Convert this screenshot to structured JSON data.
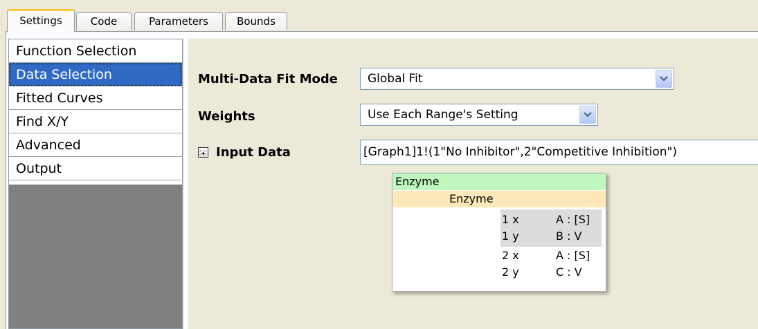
{
  "tabs": [
    {
      "label": "Settings",
      "active": true
    },
    {
      "label": "Code",
      "active": false
    },
    {
      "label": "Parameters",
      "active": false
    },
    {
      "label": "Bounds",
      "active": false
    }
  ],
  "nav": {
    "items": [
      {
        "label": "Function Selection"
      },
      {
        "label": "Data Selection",
        "selected": true
      },
      {
        "label": "Fitted Curves"
      },
      {
        "label": "Find X/Y"
      },
      {
        "label": "Advanced"
      },
      {
        "label": "Output"
      }
    ]
  },
  "form": {
    "multi_data_fit_mode": {
      "label": "Multi-Data Fit Mode",
      "value": "Global Fit"
    },
    "weights": {
      "label": "Weights",
      "value": "Use Each Range's Setting"
    },
    "input_data": {
      "label": "Input Data",
      "value": "[Graph1]1!(1\"No Inhibitor\",2\"Competitive Inhibition\")"
    }
  },
  "popup": {
    "level1": "Enzyme",
    "level2": "Enzyme",
    "rows": [
      {
        "key": "1 x",
        "value": "A : [S]",
        "highlight": true
      },
      {
        "key": "1 y",
        "value": "B : V",
        "highlight": true
      },
      {
        "key": "2 x",
        "value": "A : [S]",
        "highlight": false
      },
      {
        "key": "2 y",
        "value": "C : V",
        "highlight": false
      }
    ]
  },
  "colors": {
    "selection": "#316ac5",
    "tab_accent": "#ffc83c",
    "popup_green": "#bff7bf",
    "popup_orange": "#fce8b8"
  }
}
